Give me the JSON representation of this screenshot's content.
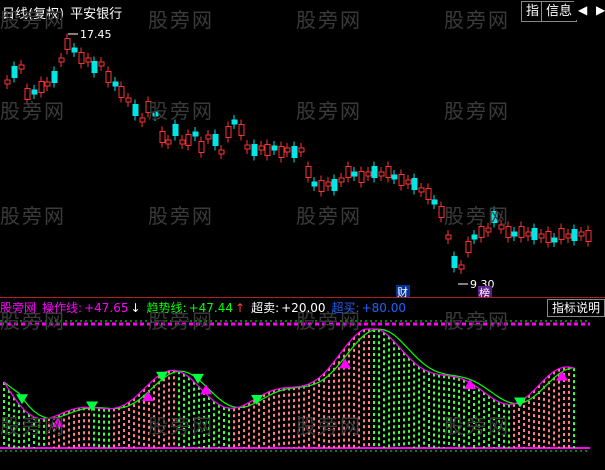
{
  "window": {
    "title": "日线(复权)",
    "stock": "平安银行"
  },
  "toolbar": {
    "btn_zhi": "指",
    "btn_xinxi": "信息",
    "btn_prev": "◀",
    "btn_next": "▶"
  },
  "price_chart": {
    "high_label": "17.45",
    "low_label": "9.30",
    "marker_cai": "财",
    "marker_bang": "榜"
  },
  "indicator": {
    "name": "股旁网",
    "cz_label": "操作线:",
    "cz_value": "+47.65",
    "cz_arrow": "↓",
    "qs_label": "趋势线:",
    "qs_value": "+47.44",
    "qs_arrow": "↑",
    "cm_label": "超卖:",
    "cm_value": "+20.00",
    "cs_label": "超买:",
    "cs_value": "+80.00",
    "button": "指标说明"
  },
  "watermark": "股旁网",
  "colors": {
    "up": "#ff3232",
    "down": "#00e5e5",
    "overbought_line": "#ff00ff",
    "oversold_line": "#ff00ff",
    "trend_line": "#00ff00",
    "op_line": "#ff00ff"
  }
}
